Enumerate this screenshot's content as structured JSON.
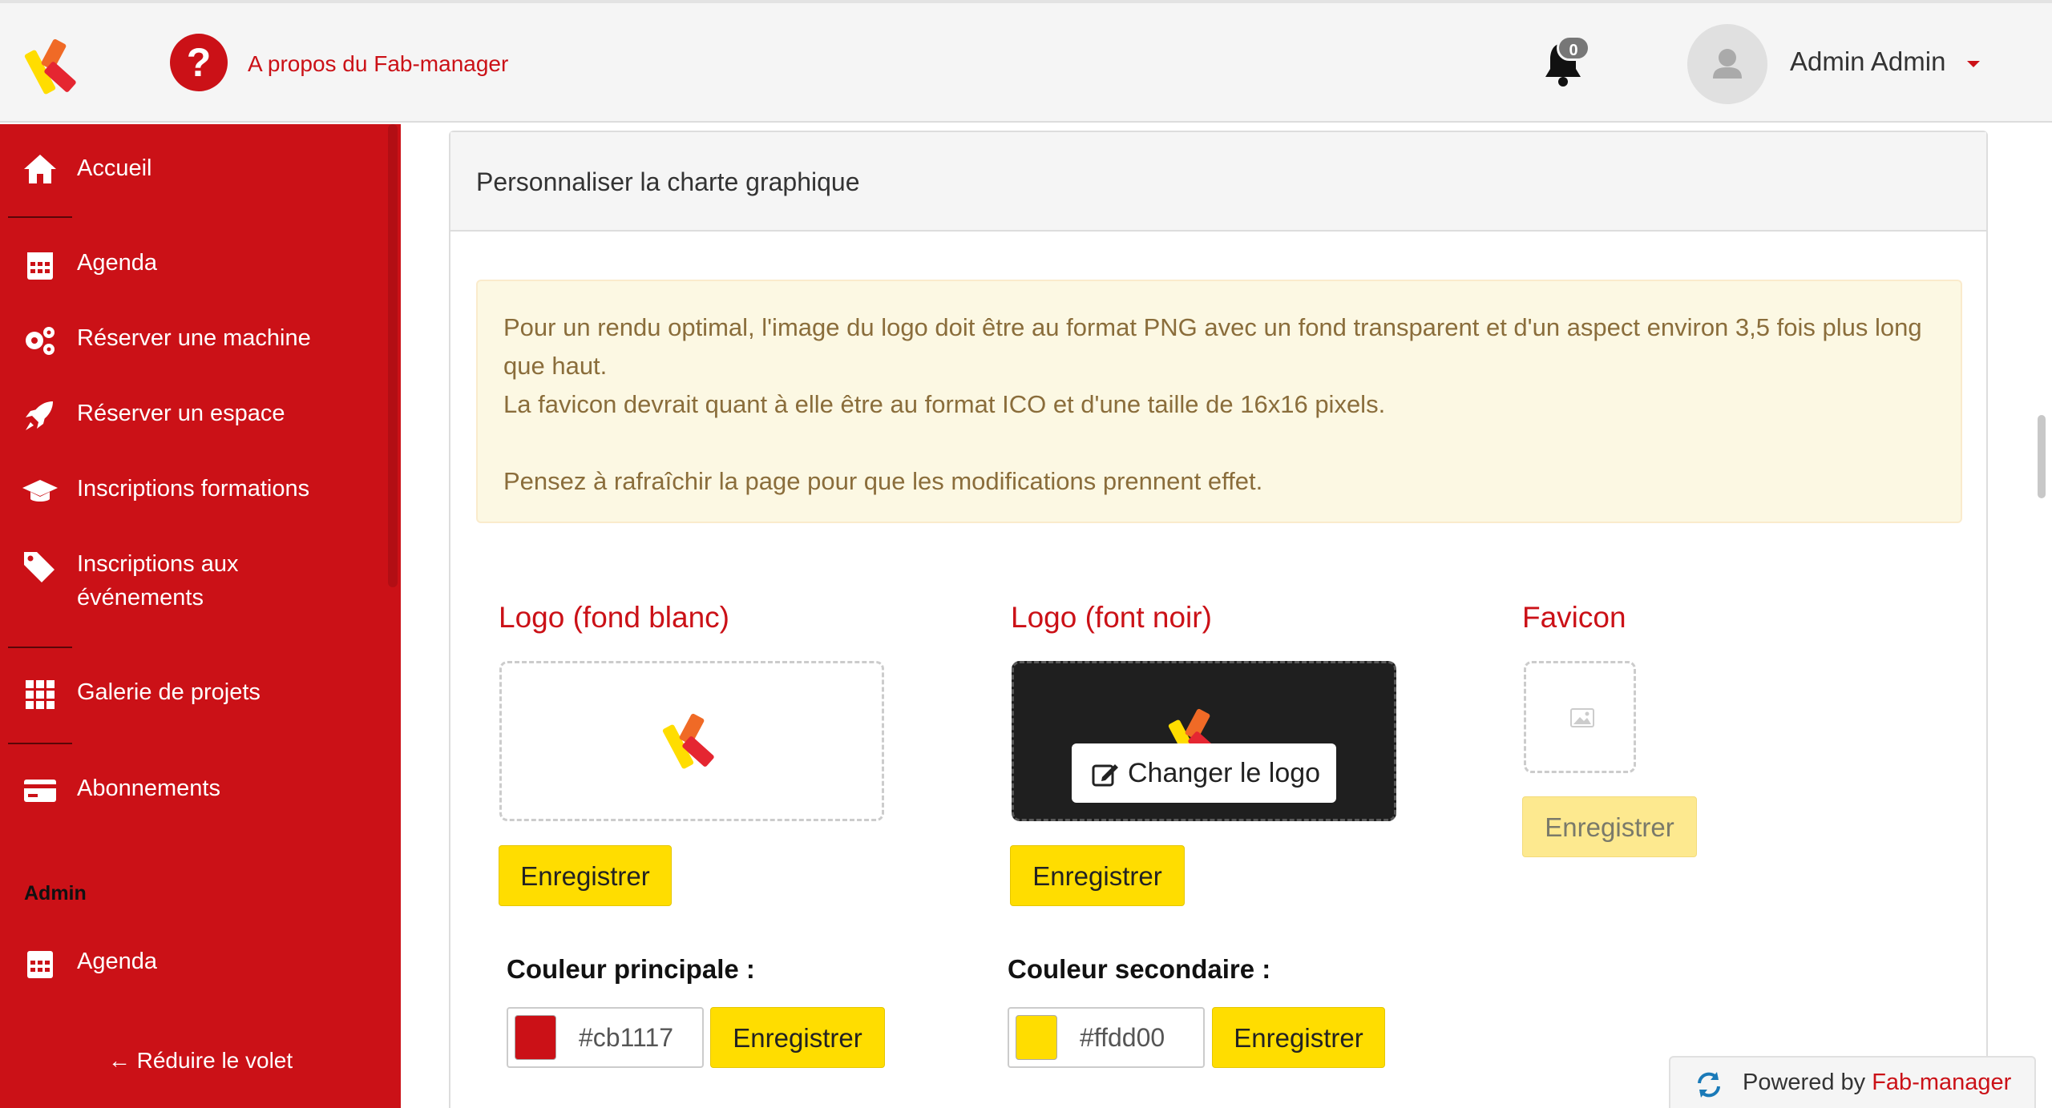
{
  "header": {
    "help_link": "A propos du Fab-manager",
    "help_icon": "question-circle-icon",
    "notifications_count": "0",
    "user_name": "Admin Admin"
  },
  "sidebar": {
    "items": [
      {
        "label": "Accueil",
        "icon": "home-icon"
      },
      {
        "label": "Agenda",
        "icon": "calendar-icon"
      },
      {
        "label": "Réserver une machine",
        "icon": "cogs-icon"
      },
      {
        "label": "Réserver un espace",
        "icon": "rocket-icon"
      },
      {
        "label": "Inscriptions formations",
        "icon": "graduation-cap-icon"
      },
      {
        "label": "Inscriptions aux événements",
        "icon": "tags-icon"
      },
      {
        "label": "Galerie de projets",
        "icon": "grid-icon"
      },
      {
        "label": "Abonnements",
        "icon": "credit-card-icon"
      }
    ],
    "admin_section": "Admin",
    "admin_items": [
      {
        "label": "Agenda",
        "icon": "calendar-icon"
      }
    ],
    "collapse_label": "Réduire le volet"
  },
  "main": {
    "panel_title": "Personnaliser la charte graphique",
    "alert": {
      "line1": "Pour un rendu optimal, l'image du logo doit être au format PNG avec un fond transparent et d'un aspect environ 3,5 fois plus long que haut.",
      "line2": "La favicon devrait quant à elle être au format ICO et d'une taille de 16x16 pixels.",
      "line3": "Pensez à rafraîchir la page pour que les modifications prennent effet."
    },
    "logo_white": {
      "title": "Logo (fond blanc)",
      "save": "Enregistrer"
    },
    "logo_black": {
      "title": "Logo (font noir)",
      "change": "Changer le logo",
      "save": "Enregistrer"
    },
    "favicon": {
      "title": "Favicon",
      "save": "Enregistrer"
    },
    "primary_color": {
      "label": "Couleur principale :",
      "value": "#cb1117",
      "save": "Enregistrer"
    },
    "secondary_color": {
      "label": "Couleur secondaire :",
      "value": "#ffdd00",
      "save": "Enregistrer"
    }
  },
  "footer": {
    "powered_prefix": "Powered by",
    "powered_link": "Fab-manager"
  },
  "colors": {
    "brand_red": "#cb1117",
    "brand_yellow": "#ffdd00"
  }
}
